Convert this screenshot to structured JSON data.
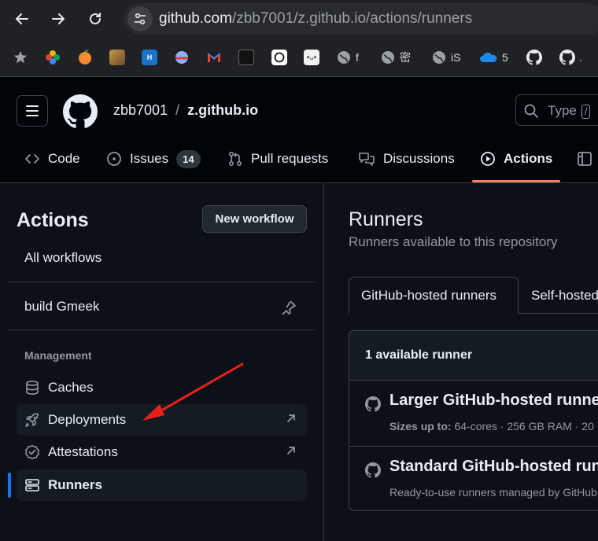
{
  "browser": {
    "url_host": "github.com",
    "url_path": "/zbb7001/z.github.io/actions/runners",
    "bookmarks": [
      {
        "label": "",
        "icon": "star-icon"
      },
      {
        "label": "",
        "icon": "photos-icon"
      },
      {
        "label": "",
        "icon": "orange-icon"
      },
      {
        "label": "",
        "icon": "image-icon"
      },
      {
        "label": "",
        "icon": "hux-icon"
      },
      {
        "label": "",
        "icon": "planet-icon"
      },
      {
        "label": "",
        "icon": "gmail-icon"
      },
      {
        "label": "",
        "icon": "spider-icon"
      },
      {
        "label": "",
        "icon": "openai-icon"
      },
      {
        "label": "",
        "icon": "face-icon"
      },
      {
        "label": "f",
        "icon": "globe-icon"
      },
      {
        "label": "密",
        "icon": "globe-icon"
      },
      {
        "label": "iS",
        "icon": "globe-icon"
      },
      {
        "label": "5",
        "icon": "onedrive-icon"
      },
      {
        "label": "",
        "icon": "github-icon"
      },
      {
        "label": ".",
        "icon": "github-icon"
      }
    ]
  },
  "header": {
    "owner": "zbb7001",
    "separator": "/",
    "repo": "z.github.io",
    "search_placeholder": "Type",
    "search_key": "/"
  },
  "tabs": [
    {
      "label": "Code",
      "icon": "code-icon"
    },
    {
      "label": "Issues",
      "icon": "issue-icon",
      "count": "14"
    },
    {
      "label": "Pull requests",
      "icon": "pull-request-icon"
    },
    {
      "label": "Discussions",
      "icon": "discussion-icon"
    },
    {
      "label": "Actions",
      "icon": "play-icon",
      "active": true
    },
    {
      "label": "",
      "icon": "project-icon"
    }
  ],
  "sidebar": {
    "title": "Actions",
    "new_workflow": "New workflow",
    "all_workflows": "All workflows",
    "workflow": "build Gmeek",
    "management_heading": "Management",
    "items": [
      {
        "label": "Caches",
        "icon": "database-icon"
      },
      {
        "label": "Deployments",
        "icon": "rocket-icon"
      },
      {
        "label": "Attestations",
        "icon": "verified-icon"
      },
      {
        "label": "Runners",
        "icon": "server-icon",
        "active": true
      }
    ]
  },
  "main": {
    "title": "Runners",
    "subtitle": "Runners available to this repository",
    "tab_github_hosted": "GitHub-hosted runners",
    "tab_self_hosted": "Self-hosted",
    "box_header": "1 available runner",
    "runners": [
      {
        "title": "Larger GitHub-hosted runners",
        "meta_label": "Sizes up to:",
        "meta_value": "64-cores · 256 GB RAM · 20"
      },
      {
        "title": "Standard GitHub-hosted runners",
        "meta_label": "",
        "meta_value": "Ready-to-use runners managed by GitHub"
      }
    ]
  },
  "colors": {
    "accent_underline": "#f78166",
    "active_bar": "#1f6feb",
    "annotation_arrow": "#e8201c"
  }
}
